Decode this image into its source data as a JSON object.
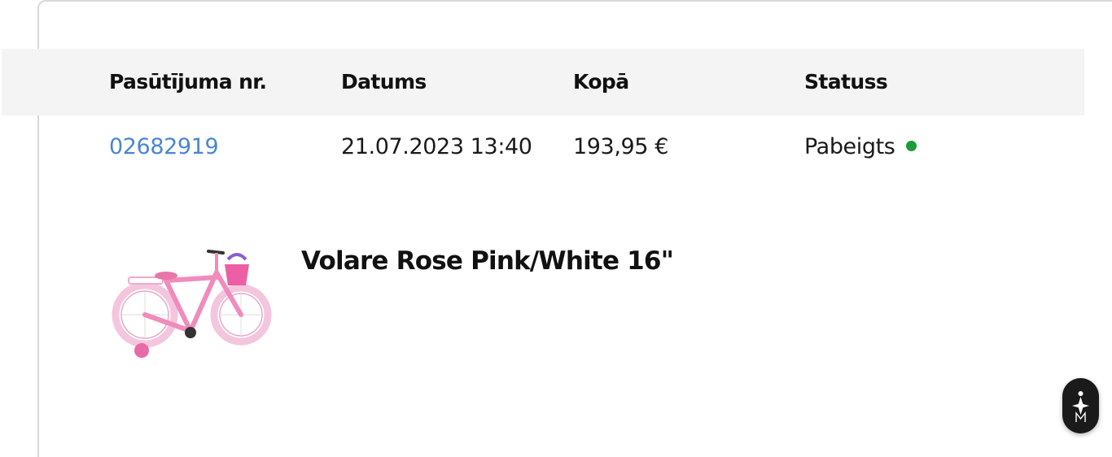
{
  "orders_table": {
    "headers": [
      "Pasūtījuma nr.",
      "Datums",
      "Kopā",
      "Statuss"
    ],
    "rows": [
      {
        "order_number": "02682919",
        "date": "21.07.2023 13:40",
        "total": "193,95 €",
        "status": "Pabeigts",
        "status_color": "#1e9c3a"
      }
    ]
  },
  "order_items": [
    {
      "name": "Volare Rose Pink/White 16\"",
      "image_icon": "pink-bicycle-image"
    }
  ],
  "colors": {
    "link": "#4a86d2",
    "header_background": "#f4f4f4",
    "status_complete": "#1e9c3a",
    "widget_background": "#1a1a1a"
  },
  "widget": {
    "icon": "accessibility-icon"
  }
}
